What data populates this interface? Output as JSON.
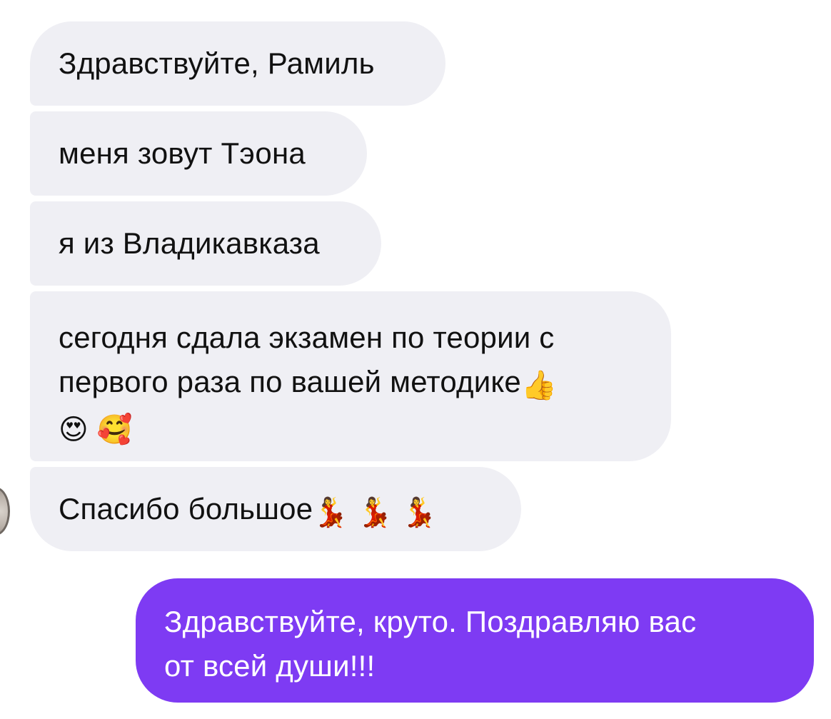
{
  "chat": {
    "incoming": [
      {
        "text": "Здравствуйте, Рамиль"
      },
      {
        "text": "меня зовут Тэона"
      },
      {
        "text": "я из Владикавказа"
      },
      {
        "line1": "сегодня сдала экзамен по теории с",
        "line2": "первого раза по вашей методике",
        "emoji_thumbs": "👍",
        "emoji_heart_eyes": "😍",
        "emoji_smiling_hearts": "🥰"
      },
      {
        "text": "Спасибо большое",
        "emoji_dancer": "💃"
      }
    ],
    "outgoing": [
      {
        "line1": "Здравствуйте, круто. Поздравляю вас",
        "line2": "от всей души!!!"
      }
    ]
  },
  "colors": {
    "incoming_bubble": "#efeff4",
    "outgoing_bubble": "#7e3bf3",
    "incoming_text": "#111111",
    "outgoing_text": "#ffffff"
  },
  "icons": {
    "avatar": "contact-avatar",
    "emoji": [
      "thumbs-up-icon",
      "heart-eyes-icon",
      "smiling-face-with-hearts-icon",
      "dancer-icon"
    ]
  }
}
